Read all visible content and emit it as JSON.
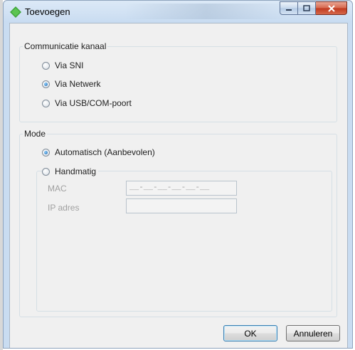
{
  "window": {
    "title": "Toevoegen"
  },
  "communication": {
    "title": "Communicatie kanaal",
    "options": [
      {
        "label": "Via SNI",
        "checked": false
      },
      {
        "label": "Via Netwerk",
        "checked": true
      },
      {
        "label": "Via USB/COM-poort",
        "checked": false
      }
    ]
  },
  "mode": {
    "title": "Mode",
    "options": [
      {
        "label": "Automatisch (Aanbevolen)",
        "checked": true
      },
      {
        "label": "Handmatig",
        "checked": false
      }
    ],
    "mac": {
      "label": "MAC",
      "value": "__-__-__-__-__-__"
    },
    "ip": {
      "label": "IP adres",
      "value": ""
    }
  },
  "buttons": {
    "ok": "OK",
    "cancel": "Annuleren"
  }
}
